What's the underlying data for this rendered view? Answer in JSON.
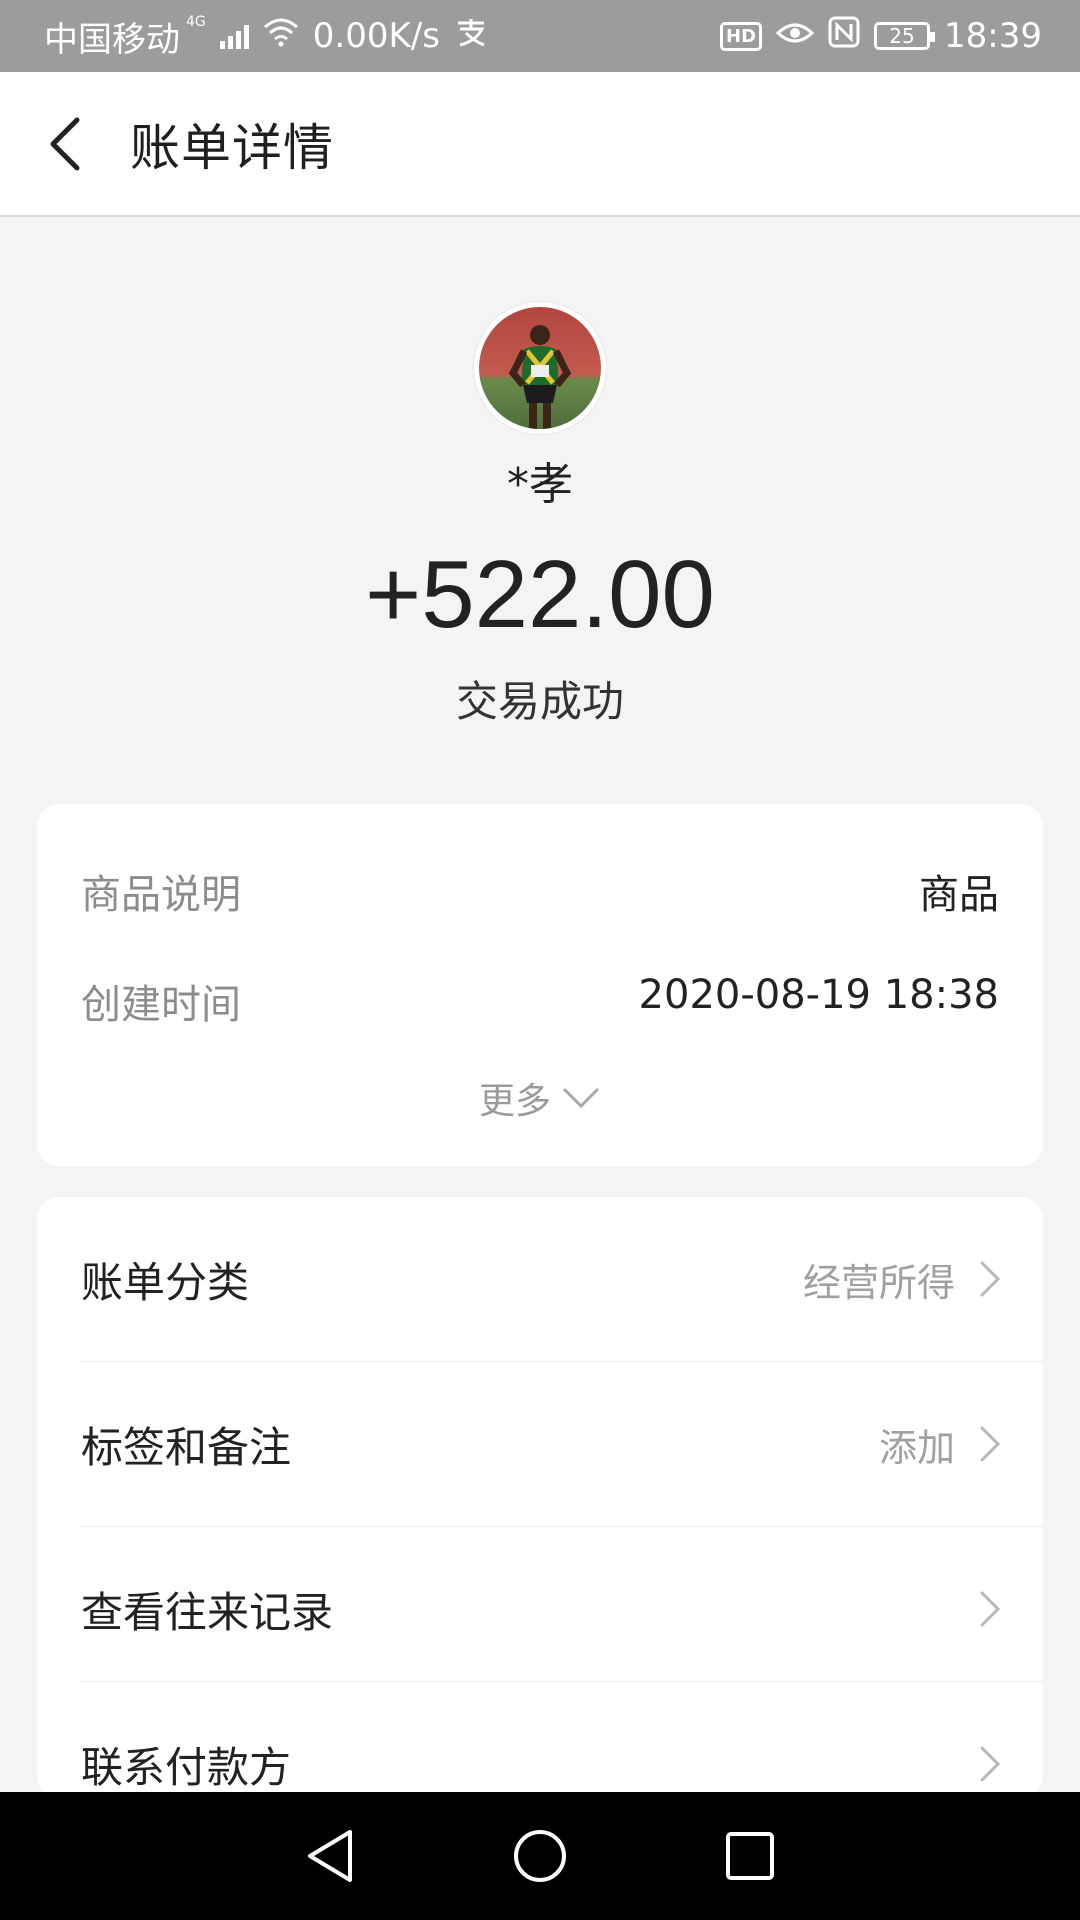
{
  "status_bar": {
    "carrier": "中国移动",
    "network": "4G",
    "speed": "0.00K/s",
    "hd": "HD",
    "battery": "25",
    "time": "18:39",
    "icons": [
      "signal-icon",
      "wifi-icon",
      "alipay-icon",
      "eye-icon",
      "nfc-icon",
      "battery-icon"
    ]
  },
  "header": {
    "title": "账单详情",
    "back_icon": "chevron-left-icon"
  },
  "summary": {
    "name": "*孝",
    "amount": "+522.00",
    "status": "交易成功"
  },
  "details": {
    "rows": [
      {
        "label": "商品说明",
        "value": "商品"
      },
      {
        "label": "创建时间",
        "value": "2020-08-19 18:38"
      }
    ],
    "more_label": "更多"
  },
  "actions": [
    {
      "label": "账单分类",
      "value": "经营所得"
    },
    {
      "label": "标签和备注",
      "value": "添加"
    },
    {
      "label": "查看往来记录",
      "value": ""
    },
    {
      "label": "联系付款方",
      "value": ""
    }
  ],
  "colors": {
    "background": "#f4f4f4",
    "status_bar": "#9c9c9c",
    "text_primary": "#222222",
    "text_secondary": "#8c8c8c"
  }
}
